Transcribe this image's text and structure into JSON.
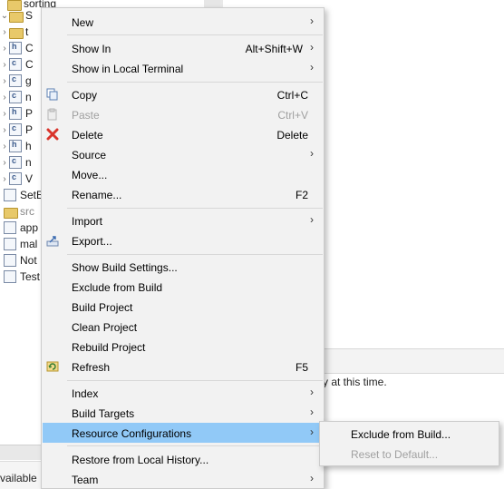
{
  "explorer": {
    "rows": [
      {
        "label": "sorting",
        "icon": "folder"
      },
      {
        "label": "S",
        "icon": "folder"
      },
      {
        "label": "t",
        "icon": "folder"
      },
      {
        "label": "C",
        "icon": "h-file"
      },
      {
        "label": "C",
        "icon": "c-file"
      },
      {
        "label": "g",
        "icon": "c-file"
      },
      {
        "label": "n",
        "icon": "c-file"
      },
      {
        "label": "P",
        "icon": "h-file"
      },
      {
        "label": "P",
        "icon": "c-file"
      },
      {
        "label": "h",
        "icon": "h-file"
      },
      {
        "label": "n",
        "icon": "c-file"
      },
      {
        "label": "V",
        "icon": "c-file"
      },
      {
        "label": "SetB",
        "icon": "project"
      },
      {
        "label": "src",
        "icon": "folder"
      },
      {
        "label": "app",
        "icon": "file"
      },
      {
        "label": "mal",
        "icon": "file"
      },
      {
        "label": "Not",
        "icon": "file"
      },
      {
        "label": "Test",
        "icon": "file"
      }
    ],
    "status_text": "vailable"
  },
  "right_panel": {
    "message": "y at this time."
  },
  "context_menu": {
    "items": [
      {
        "label": "New",
        "shortcut": "",
        "submenu": true
      },
      {
        "label": "Show In",
        "shortcut": "Alt+Shift+W",
        "submenu": true
      },
      {
        "label": "Show in Local Terminal",
        "shortcut": "",
        "submenu": true
      },
      {
        "label": "Copy",
        "shortcut": "Ctrl+C",
        "icon": "copy-icon"
      },
      {
        "label": "Paste",
        "shortcut": "Ctrl+V",
        "icon": "paste-icon",
        "disabled": true
      },
      {
        "label": "Delete",
        "shortcut": "Delete",
        "icon": "delete-icon"
      },
      {
        "label": "Source",
        "shortcut": "",
        "submenu": true
      },
      {
        "label": "Move...",
        "shortcut": ""
      },
      {
        "label": "Rename...",
        "shortcut": "F2"
      },
      {
        "label": "Import",
        "shortcut": "",
        "submenu": true
      },
      {
        "label": "Export...",
        "shortcut": "",
        "icon": "export-icon"
      },
      {
        "label": "Show Build Settings...",
        "shortcut": ""
      },
      {
        "label": "Exclude from Build",
        "shortcut": ""
      },
      {
        "label": "Build Project",
        "shortcut": ""
      },
      {
        "label": "Clean Project",
        "shortcut": ""
      },
      {
        "label": "Rebuild Project",
        "shortcut": ""
      },
      {
        "label": "Refresh",
        "shortcut": "F5",
        "icon": "refresh-icon"
      },
      {
        "label": "Index",
        "shortcut": "",
        "submenu": true
      },
      {
        "label": "Build Targets",
        "shortcut": "",
        "submenu": true
      },
      {
        "label": "Resource Configurations",
        "shortcut": "",
        "submenu": true,
        "highlighted": true
      },
      {
        "label": "Restore from Local History...",
        "shortcut": ""
      },
      {
        "label": "Team",
        "shortcut": "",
        "submenu": true
      }
    ],
    "submenu_arrow": "›"
  },
  "resource_configurations_submenu": {
    "items": [
      {
        "label": "Exclude from Build..."
      },
      {
        "label": "Reset to Default...",
        "disabled": true
      }
    ]
  },
  "colors": {
    "highlight": "#91c9f7",
    "menu_bg": "#f2f2f2",
    "disabled_text": "#a0a0a0",
    "delete_red": "#d9342b"
  }
}
